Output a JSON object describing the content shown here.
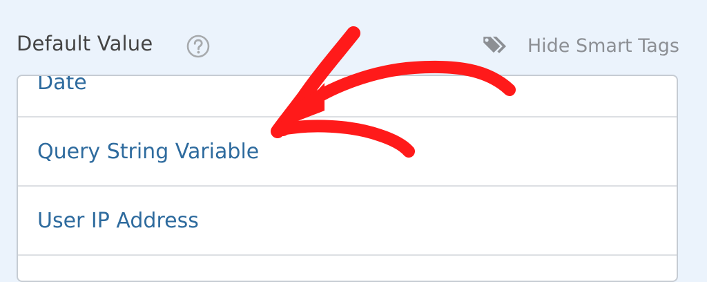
{
  "field": {
    "label": "Default Value",
    "help_icon": "question-circle-icon",
    "smart_tags_icon": "tags-icon",
    "smart_tags_toggle_label": "Hide Smart Tags"
  },
  "smart_tags": {
    "items": [
      {
        "label": "Date"
      },
      {
        "label": "Query String Variable"
      },
      {
        "label": "User IP Address"
      }
    ]
  },
  "colors": {
    "background": "#ebf3fc",
    "tag_text": "#2e6b9e",
    "annotation_arrow": "#ff1a1a"
  }
}
